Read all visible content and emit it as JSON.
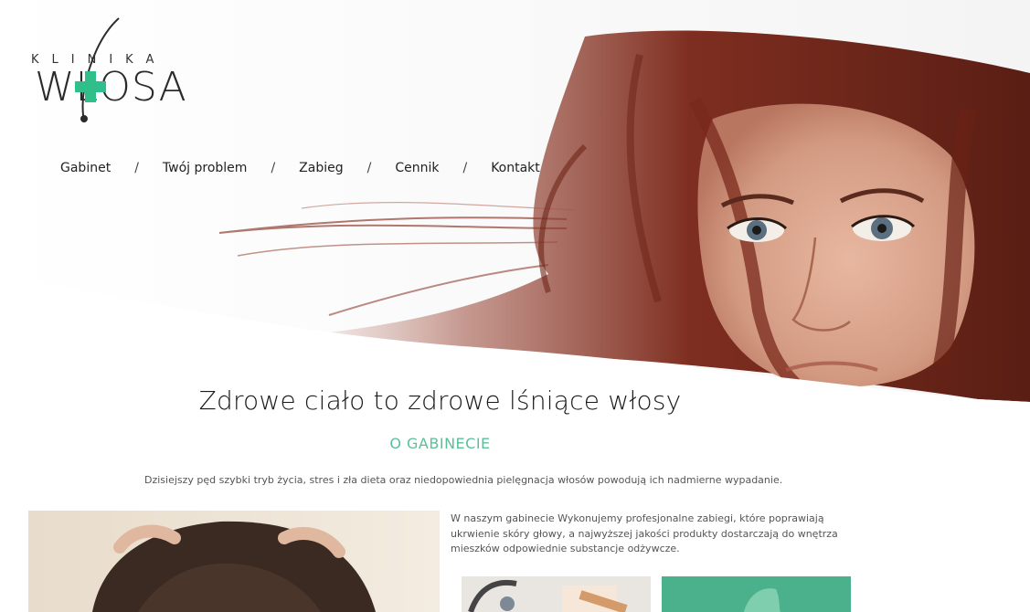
{
  "brand": {
    "logo_top": "KLINIKA",
    "logo_main": "WŁOSA",
    "accent_color": "#2fbf8a"
  },
  "nav": {
    "items": [
      {
        "label": "Gabinet"
      },
      {
        "label": "Twój problem"
      },
      {
        "label": "Zabieg"
      },
      {
        "label": "Cennik"
      },
      {
        "label": "Kontakt"
      }
    ],
    "separator": "/"
  },
  "content": {
    "headline": "Zdrowe ciało to zdrowe lśniące włosy",
    "section_title": "O GABINECIE",
    "intro": "Dzisiejszy pęd szybki tryb życia, stres i zła dieta oraz niedopowiednia pielęgnacja włosów powodują ich nadmierne wypadanie.",
    "paragraph": "W naszym gabinecie Wykonujemy profesjonalne zabiegi, które poprawiają ukrwienie skóry głowy, a najwyższej jakości produkty dostarczają do wnętrza mieszków odpowiednie substancje odżywcze."
  },
  "colors": {
    "section_title": "#5cbf9a",
    "text": "#555555",
    "hair": "#8a3324"
  }
}
